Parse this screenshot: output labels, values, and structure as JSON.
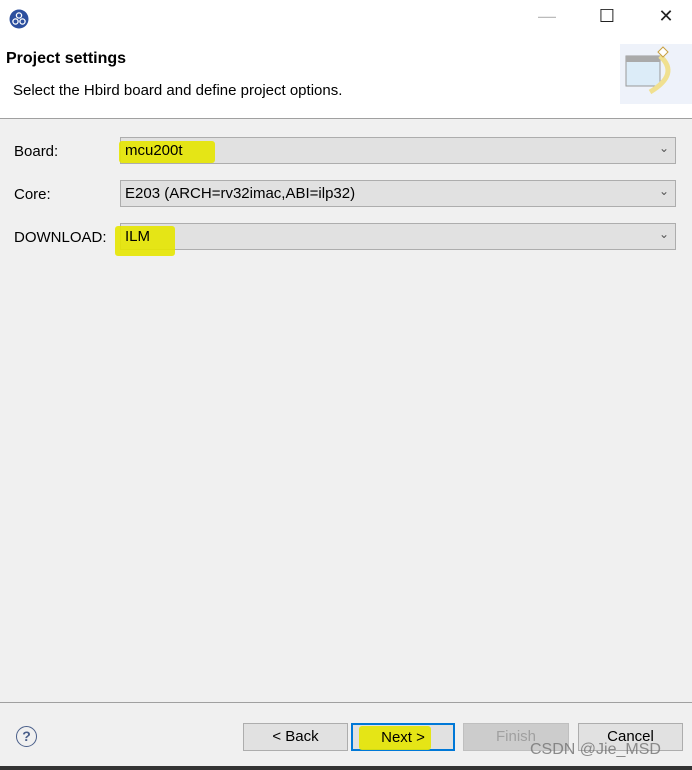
{
  "window": {
    "title_controls": {
      "minimize": "—",
      "maximize": "☐",
      "close": "✕"
    }
  },
  "header": {
    "title": "Project settings",
    "subtitle": "Select the Hbird board and define project options."
  },
  "form": {
    "board": {
      "label": "Board:",
      "value": "mcu200t"
    },
    "core": {
      "label": "Core:",
      "value": "E203 (ARCH=rv32imac,ABI=ilp32)"
    },
    "download": {
      "label": "DOWNLOAD:",
      "value": "ILM"
    }
  },
  "footer": {
    "help": "?",
    "back": "< Back",
    "next": "Next >",
    "finish": "Finish",
    "cancel": "Cancel"
  },
  "watermark": "CSDN @Jie_MSD",
  "colors": {
    "highlight": "#e6e600",
    "default_button_border": "#0078d7"
  }
}
